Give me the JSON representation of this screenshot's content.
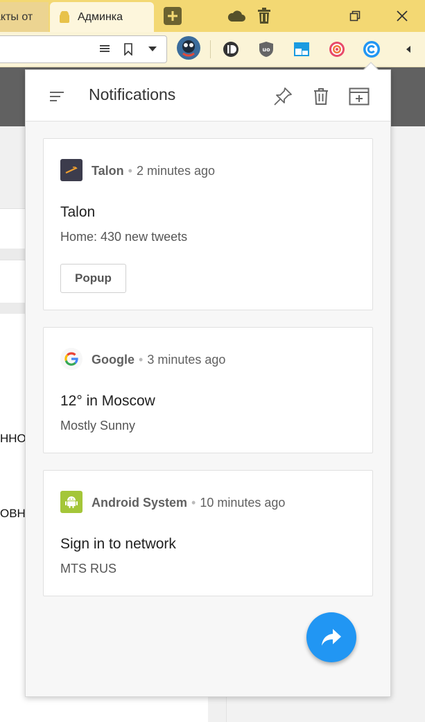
{
  "browser": {
    "tabs": [
      {
        "label": "акты от"
      },
      {
        "label": "Админка"
      }
    ]
  },
  "page_behind": {
    "text_lines": [
      "ННОІ",
      "ОВНІ"
    ]
  },
  "panel": {
    "title": "Notifications"
  },
  "notifications": [
    {
      "app": "Talon",
      "time": "2 minutes ago",
      "title": "Talon",
      "body": "Home: 430 new tweets",
      "action": "Popup",
      "icon": "talon-icon"
    },
    {
      "app": "Google",
      "time": "3 minutes ago",
      "title": "12° in Moscow",
      "body": "Mostly Sunny",
      "icon": "google-icon"
    },
    {
      "app": "Android System",
      "time": "10 minutes ago",
      "title": "Sign in to network",
      "body": "MTS RUS",
      "icon": "android-icon"
    }
  ],
  "colors": {
    "tabbar": "#f3d873",
    "accent": "#2196f3",
    "android": "#a4c639",
    "talon": "#3c3c4c"
  }
}
